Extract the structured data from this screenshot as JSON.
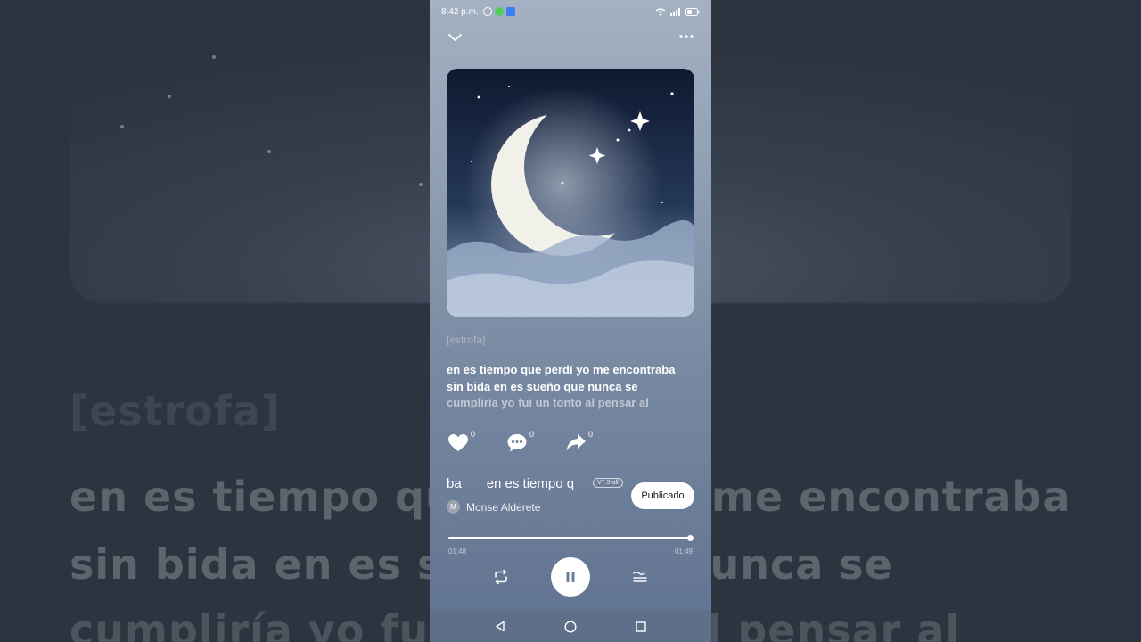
{
  "status_bar": {
    "time": "8:42 p.m."
  },
  "background": {
    "lyric_tag": "[estrofa]",
    "lyric_line_1": "en es tiempo que perdí yo me encontraba",
    "lyric_line_2": "sin bida en es sueño que nunca se",
    "lyric_line_3": "cumpliría yo fui un tonto al pensar al"
  },
  "player": {
    "lyrics": {
      "previous": "[estrofa]",
      "lines": [
        "en es tiempo que perdí yo me encontraba",
        "sin bida en es sueño que nunca se",
        "cumpliría yo fui un tonto al pensar al"
      ]
    },
    "actions": {
      "like_count": "0",
      "comment_count": "0",
      "share_count": "0"
    },
    "song": {
      "marquee_tail": "ba",
      "marquee_head": "en es tiempo q",
      "version_badge": "V7.5-all",
      "author_initial": "M",
      "author_name": "Monse Alderete"
    },
    "publish_label": "Publicado",
    "progress": {
      "current": "01:48",
      "total": "01:49",
      "fraction": 0.99
    }
  },
  "icons": {
    "collapse": "chevron-down-icon",
    "more": "more-dots-icon",
    "like": "heart-icon",
    "comment": "comment-icon",
    "share": "share-icon",
    "repeat": "repeat-icon",
    "pause": "pause-icon",
    "playlist": "playlist-icon",
    "nav_back": "back-icon",
    "nav_home": "home-icon",
    "nav_recent": "recent-apps-icon"
  },
  "colors": {
    "panel_top": "#a3b1c2",
    "panel_bottom": "#5f7290",
    "accent": "#ffffff"
  }
}
